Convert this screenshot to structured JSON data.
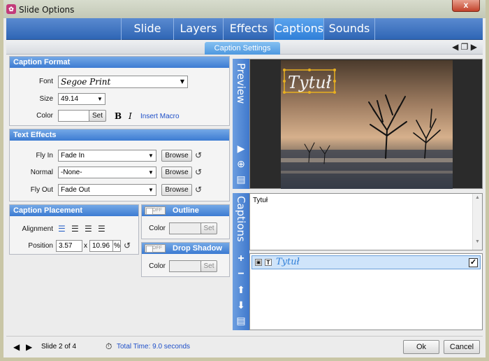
{
  "window": {
    "title": "Slide Options",
    "close": "x"
  },
  "tabs": [
    {
      "label": "Slide"
    },
    {
      "label": "Layers"
    },
    {
      "label": "Effects"
    },
    {
      "label": "Captions"
    },
    {
      "label": "Sounds"
    }
  ],
  "subtab": "Caption Settings",
  "caption_format": {
    "title": "Caption Format",
    "font_label": "Font",
    "font_value": "Segoe Print",
    "size_label": "Size",
    "size_value": "49.14",
    "color_label": "Color",
    "set_label": "Set",
    "bold": "B",
    "italic": "I",
    "insert_macro": "Insert Macro"
  },
  "text_effects": {
    "title": "Text Effects",
    "flyin_label": "Fly In",
    "flyin_value": "Fade In",
    "normal_label": "Normal",
    "normal_value": "-None-",
    "flyout_label": "Fly Out",
    "flyout_value": "Fade Out",
    "browse": "Browse"
  },
  "placement": {
    "title": "Caption Placement",
    "alignment_label": "Alignment",
    "position_label": "Position",
    "pos_x": "3.57",
    "x_sep": "x",
    "pos_y": "10.96",
    "percent": "%"
  },
  "outline": {
    "title": "Outline",
    "off": "OFF",
    "color_label": "Color",
    "set": "Set"
  },
  "shadow": {
    "title": "Drop Shadow",
    "off": "OFF",
    "color_label": "Color",
    "set": "Set"
  },
  "preview": {
    "label": "Preview",
    "caption_text": "Tytuł"
  },
  "captions": {
    "label": "Captions",
    "text": "Tytuł",
    "list_item": "Tytuł"
  },
  "footer": {
    "slide_info": "Slide 2 of 4",
    "total_time": "Total Time: 9.0 seconds",
    "ok": "Ok",
    "cancel": "Cancel"
  },
  "colors": {
    "accent": "#3c7bd2",
    "caption_text": "#f2f2f2"
  }
}
